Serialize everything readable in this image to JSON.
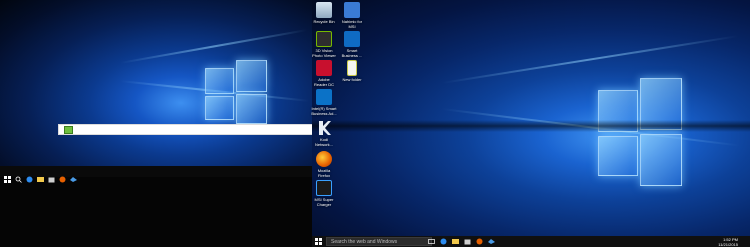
{
  "colors": {
    "accent": "#1a63d0",
    "taskbar": "#101010",
    "icon_text": "#ffffff"
  },
  "desktop_icons": [
    {
      "label": "Recycle Bin",
      "icon": "recycle-bin-icon"
    },
    {
      "label": "Nahimic for\nMSI",
      "icon": "nahimic-icon"
    },
    {
      "label": "3D Vision\nPhoto Viewer",
      "icon": "3d-vision-icon"
    },
    {
      "label": "Smart\nBusiness ...",
      "icon": "smart-business-icon"
    },
    {
      "label": "Adobe\nReader DC",
      "icon": "acrobat-icon"
    },
    {
      "label": "New folder",
      "icon": "folder-icon"
    },
    {
      "label": "Intel(R) Smart\nBusiness Ad...",
      "icon": "intel-icon"
    },
    {
      "label": "Kodi\nNetwork...",
      "icon": "kodi-icon"
    },
    {
      "label": "Mozilla\nFirefox",
      "icon": "firefox-icon"
    },
    {
      "label": "MSI Super\nCharger",
      "icon": "msi-charger-icon"
    }
  ],
  "taskbar": {
    "search_placeholder": "Search the web and Windows",
    "time": "1:52 PM",
    "date": "11/21/2015"
  }
}
